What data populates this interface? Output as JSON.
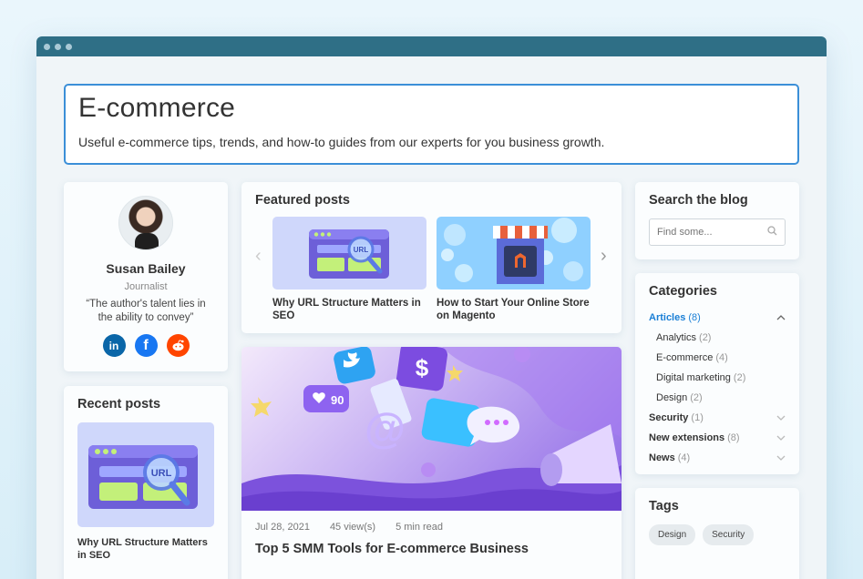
{
  "hero": {
    "title": "E-commerce",
    "subtitle": "Useful e-commerce tips, trends, and how-to guides from our experts for you business growth."
  },
  "author": {
    "name": "Susan Bailey",
    "role": "Journalist",
    "quote": "“The author's talent lies in the ability to convey”",
    "socials": [
      "linkedin-icon",
      "facebook-icon",
      "reddit-icon"
    ]
  },
  "recent": {
    "title": "Recent posts",
    "post_title": "Why URL Structure Matters in SEO"
  },
  "featured": {
    "title": "Featured posts",
    "posts": [
      {
        "title": "Why URL Structure Matters in SEO"
      },
      {
        "title": "How to Start Your Online Store on Magento"
      }
    ]
  },
  "big_post": {
    "date": "Jul 28, 2021",
    "views": "45 view(s)",
    "read": "5 min read",
    "title": "Top 5 SMM Tools for E-commerce Business",
    "likes": "90"
  },
  "search": {
    "title": "Search the blog",
    "placeholder": "Find some..."
  },
  "categories": {
    "title": "Categories",
    "items": [
      {
        "label": "Articles",
        "count": "(8)"
      },
      {
        "label": "Analytics",
        "count": "(2)"
      },
      {
        "label": "E-commerce",
        "count": "(4)"
      },
      {
        "label": "Digital marketing",
        "count": "(2)"
      },
      {
        "label": "Design",
        "count": "(2)"
      },
      {
        "label": "Security",
        "count": "(1)"
      },
      {
        "label": "New extensions",
        "count": "(8)"
      },
      {
        "label": "News",
        "count": "(4)"
      }
    ]
  },
  "tags": {
    "title": "Tags",
    "items": [
      "Design",
      "Security"
    ]
  },
  "colors": {
    "titlebar": "#2f6f86",
    "accent": "#1a7fd6",
    "hero_border": "#3b8fd8"
  }
}
